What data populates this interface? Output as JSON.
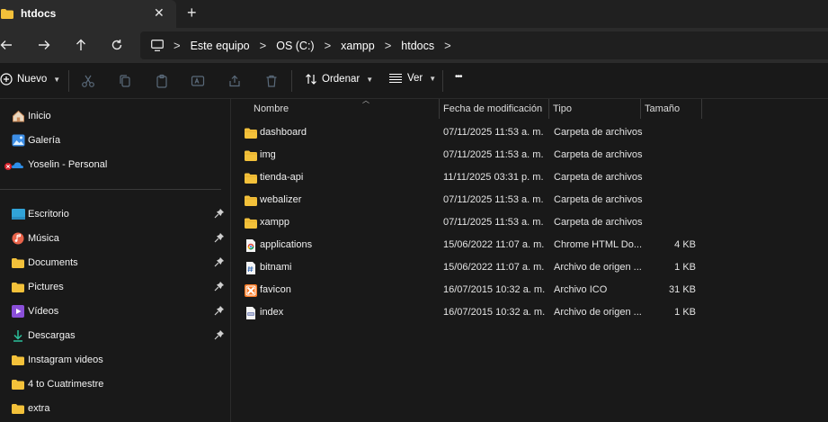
{
  "tab": {
    "title": "htdocs",
    "close_glyph": "✕",
    "new_glyph": "+"
  },
  "nav": {
    "back_icon": "arrow-left-icon",
    "forward_icon": "arrow-right-icon",
    "up_icon": "arrow-up-icon",
    "refresh_icon": "refresh-icon"
  },
  "breadcrumb": {
    "separator": ">",
    "items": [
      "Este equipo",
      "OS (C:)",
      "xampp",
      "htdocs"
    ]
  },
  "commandbar": {
    "new_label": "Nuevo",
    "sort_label": "Ordenar",
    "view_label": "Ver",
    "more_glyph": "•••"
  },
  "sidebar": {
    "quick": [
      {
        "label": "Inicio",
        "icon": "home-icon"
      },
      {
        "label": "Galería",
        "icon": "gallery-icon"
      },
      {
        "label": "Yoselin - Personal",
        "icon": "onedrive-icon"
      }
    ],
    "pinned": [
      {
        "label": "Escritorio",
        "icon": "desktop-icon",
        "pinned": true
      },
      {
        "label": "Música",
        "icon": "music-icon",
        "pinned": true
      },
      {
        "label": "Documents",
        "icon": "folder-icon",
        "pinned": true
      },
      {
        "label": "Pictures",
        "icon": "folder-icon",
        "pinned": true
      },
      {
        "label": "Vídeos",
        "icon": "video-icon",
        "pinned": true
      },
      {
        "label": "Descargas",
        "icon": "download-icon",
        "pinned": true
      },
      {
        "label": "Instagram videos",
        "icon": "folder-icon",
        "pinned": false
      },
      {
        "label": "4 to Cuatrimestre",
        "icon": "folder-icon",
        "pinned": false
      },
      {
        "label": "extra",
        "icon": "folder-icon",
        "pinned": false
      }
    ]
  },
  "columns": {
    "name": "Nombre",
    "modified": "Fecha de modificación",
    "type": "Tipo",
    "size": "Tamaño"
  },
  "files": [
    {
      "name": "dashboard",
      "modified": "07/11/2025 11:53 a. m.",
      "type": "Carpeta de archivos",
      "size": "",
      "icon": "folder-icon"
    },
    {
      "name": "img",
      "modified": "07/11/2025 11:53 a. m.",
      "type": "Carpeta de archivos",
      "size": "",
      "icon": "folder-icon"
    },
    {
      "name": "tienda-api",
      "modified": "11/11/2025 03:31 p. m.",
      "type": "Carpeta de archivos",
      "size": "",
      "icon": "folder-icon"
    },
    {
      "name": "webalizer",
      "modified": "07/11/2025 11:53 a. m.",
      "type": "Carpeta de archivos",
      "size": "",
      "icon": "folder-icon"
    },
    {
      "name": "xampp",
      "modified": "07/11/2025 11:53 a. m.",
      "type": "Carpeta de archivos",
      "size": "",
      "icon": "folder-icon"
    },
    {
      "name": "applications",
      "modified": "15/06/2022 11:07 a. m.",
      "type": "Chrome HTML Do...",
      "size": "4 KB",
      "icon": "chrome-html-icon"
    },
    {
      "name": "bitnami",
      "modified": "15/06/2022 11:07 a. m.",
      "type": "Archivo de origen ...",
      "size": "1 KB",
      "icon": "source-file-icon"
    },
    {
      "name": "favicon",
      "modified": "16/07/2015 10:32 a. m.",
      "type": "Archivo ICO",
      "size": "31 KB",
      "icon": "xampp-icon"
    },
    {
      "name": "index",
      "modified": "16/07/2015 10:32 a. m.",
      "type": "Archivo de origen ...",
      "size": "1 KB",
      "icon": "php-file-icon"
    }
  ],
  "colors": {
    "folder": "#f3c13a",
    "background": "#191919",
    "chrome_bar": "#2b2b2b",
    "xampp": "#fb7a24"
  }
}
